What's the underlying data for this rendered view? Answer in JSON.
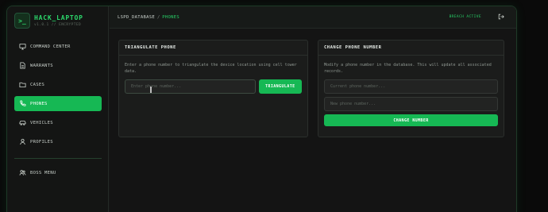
{
  "brand": {
    "logo_glyph": ">_",
    "title": "HACK_LAPTOP",
    "subtitle": "v1.0.1 // ENCRYPTED"
  },
  "sidebar": {
    "items": [
      {
        "label": "COMMAND CENTER",
        "icon": "monitor-icon"
      },
      {
        "label": "WARRANTS",
        "icon": "document-icon"
      },
      {
        "label": "CASES",
        "icon": "folder-icon"
      },
      {
        "label": "PHONES",
        "icon": "phone-icon",
        "active": true
      },
      {
        "label": "VEHICLES",
        "icon": "car-icon"
      },
      {
        "label": "PROFILES",
        "icon": "user-icon"
      }
    ],
    "boss": {
      "label": "BOSS MENU",
      "icon": "users-icon"
    }
  },
  "header": {
    "breadcrumb_root": "LSPD_DATABASE",
    "breadcrumb_sep": "/",
    "breadcrumb_current": "PHONES",
    "status": "BREACH ACTIVE",
    "logout_icon": "logout-icon"
  },
  "triangulate": {
    "title": "TRIANGULATE PHONE",
    "description": "Enter a phone number to triangulate the device location using cell tower data.",
    "placeholder": "Enter phone number...",
    "button": "TRIANGULATE"
  },
  "change": {
    "title": "CHANGE PHONE NUMBER",
    "description": "Modify a phone number in the database. This will update all associated records.",
    "current_placeholder": "Current phone number...",
    "new_placeholder": "New phone number...",
    "button": "CHANGE NUMBER"
  },
  "colors": {
    "accent": "#16b854",
    "accent_text": "#27cf66",
    "background": "#0a0a0a",
    "panel": "#1b1c1b"
  }
}
